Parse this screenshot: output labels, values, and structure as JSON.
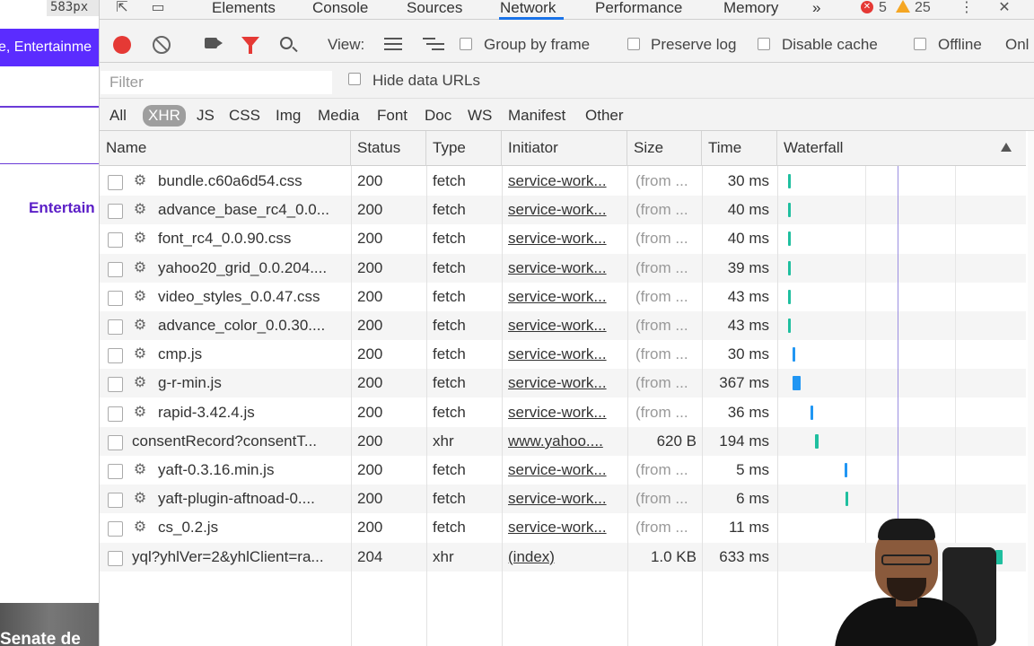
{
  "left_page": {
    "px_badge": "583px",
    "banner_text": "e, Entertainme",
    "entertainment_link": "Entertain",
    "bottom_headline": "Senate de"
  },
  "tabs": [
    {
      "label": "Elements"
    },
    {
      "label": "Console"
    },
    {
      "label": "Sources"
    },
    {
      "label": "Network"
    },
    {
      "label": "Performance"
    },
    {
      "label": "Memory"
    }
  ],
  "active_tab": "Network",
  "more_tabs": "»",
  "error_count": "5",
  "warning_count": "25",
  "toolbar": {
    "view_label": "View:",
    "group_by_frame": "Group by frame",
    "preserve_log": "Preserve log",
    "disable_cache": "Disable cache",
    "offline": "Offline",
    "online": "Onl"
  },
  "filter": {
    "placeholder": "Filter",
    "hide_data_urls": "Hide data URLs"
  },
  "type_filters": [
    "All",
    "XHR",
    "JS",
    "CSS",
    "Img",
    "Media",
    "Font",
    "Doc",
    "WS",
    "Manifest",
    "Other"
  ],
  "active_type_filter": "XHR",
  "columns": [
    "Name",
    "Status",
    "Type",
    "Initiator",
    "Size",
    "Time",
    "Waterfall"
  ],
  "rows": [
    {
      "name": "bundle.c60a6d54.css",
      "status": "200",
      "type": "fetch",
      "initiator": "service-work...",
      "size": "(from ...",
      "time": "30 ms",
      "sw": true
    },
    {
      "name": "advance_base_rc4_0.0...",
      "status": "200",
      "type": "fetch",
      "initiator": "service-work...",
      "size": "(from ...",
      "time": "40 ms",
      "sw": true
    },
    {
      "name": "font_rc4_0.0.90.css",
      "status": "200",
      "type": "fetch",
      "initiator": "service-work...",
      "size": "(from ...",
      "time": "40 ms",
      "sw": true
    },
    {
      "name": "yahoo20_grid_0.0.204....",
      "status": "200",
      "type": "fetch",
      "initiator": "service-work...",
      "size": "(from ...",
      "time": "39 ms",
      "sw": true
    },
    {
      "name": "video_styles_0.0.47.css",
      "status": "200",
      "type": "fetch",
      "initiator": "service-work...",
      "size": "(from ...",
      "time": "43 ms",
      "sw": true
    },
    {
      "name": "advance_color_0.0.30....",
      "status": "200",
      "type": "fetch",
      "initiator": "service-work...",
      "size": "(from ...",
      "time": "43 ms",
      "sw": true
    },
    {
      "name": "cmp.js",
      "status": "200",
      "type": "fetch",
      "initiator": "service-work...",
      "size": "(from ...",
      "time": "30 ms",
      "sw": true
    },
    {
      "name": "g-r-min.js",
      "status": "200",
      "type": "fetch",
      "initiator": "service-work...",
      "size": "(from ...",
      "time": "367 ms",
      "sw": true
    },
    {
      "name": "rapid-3.42.4.js",
      "status": "200",
      "type": "fetch",
      "initiator": "service-work...",
      "size": "(from ...",
      "time": "36 ms",
      "sw": true
    },
    {
      "name": "consentRecord?consentT...",
      "status": "200",
      "type": "xhr",
      "initiator": "www.yahoo....",
      "size": "620 B",
      "time": "194 ms",
      "sw": false
    },
    {
      "name": "yaft-0.3.16.min.js",
      "status": "200",
      "type": "fetch",
      "initiator": "service-work...",
      "size": "(from ...",
      "time": "5 ms",
      "sw": true
    },
    {
      "name": "yaft-plugin-aftnoad-0....",
      "status": "200",
      "type": "fetch",
      "initiator": "service-work...",
      "size": "(from ...",
      "time": "6 ms",
      "sw": true
    },
    {
      "name": "cs_0.2.js",
      "status": "200",
      "type": "fetch",
      "initiator": "service-work...",
      "size": "(from ...",
      "time": "11 ms",
      "sw": true
    },
    {
      "name": "yql?yhlVer=2&yhlClient=ra...",
      "status": "204",
      "type": "xhr",
      "initiator": "(index)",
      "size": "1.0 KB",
      "time": "633 ms",
      "sw": false
    }
  ],
  "colors": {
    "waterfall_teal": "#1fbf9f",
    "waterfall_blue": "#2196f3",
    "record_red": "#e53935",
    "active_tab_blue": "#1a73e8"
  }
}
